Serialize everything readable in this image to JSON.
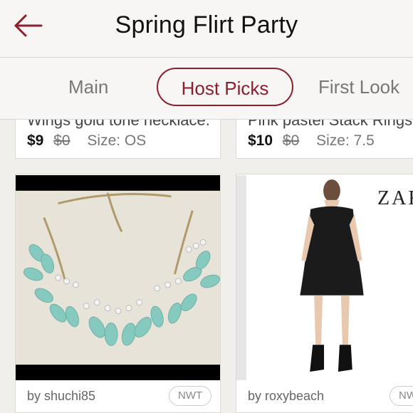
{
  "header": {
    "title": "Spring Flirt Party"
  },
  "tabs": [
    {
      "label": "Main"
    },
    {
      "label": "Host Picks"
    },
    {
      "label": "First Look"
    }
  ],
  "top_listings": [
    {
      "title": "Wings gold tone necklace.",
      "price": "$9",
      "original_price": "$0",
      "size": "Size: OS"
    },
    {
      "title": "Pink pastel Stack Rings",
      "price": "$10",
      "original_price": "$0",
      "size": "Size: 7.5"
    }
  ],
  "listings": [
    {
      "seller": "by shuchi85",
      "badge": "NWT"
    },
    {
      "seller": "by roxybeach",
      "badge": "NWT",
      "brand_text": "ZARA"
    }
  ],
  "colors": {
    "accent": "#8c1f2d",
    "background": "#f1efeb"
  }
}
